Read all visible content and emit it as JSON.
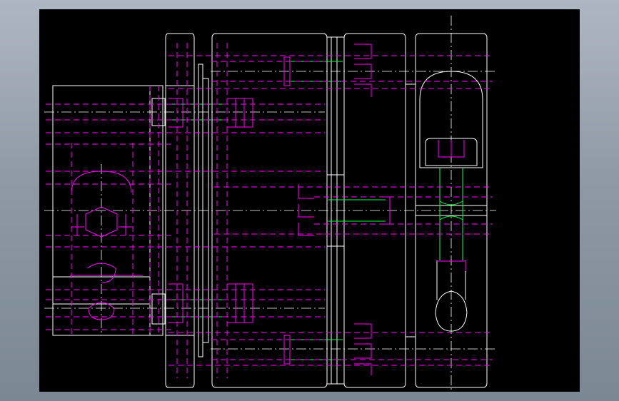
{
  "drawing": {
    "title": "",
    "background": "#000000",
    "outline_color": "#ffffff",
    "hidden_line_color": "#ff00ff",
    "thread_color": "#00ff40",
    "frame_color": "#8f99a5"
  }
}
